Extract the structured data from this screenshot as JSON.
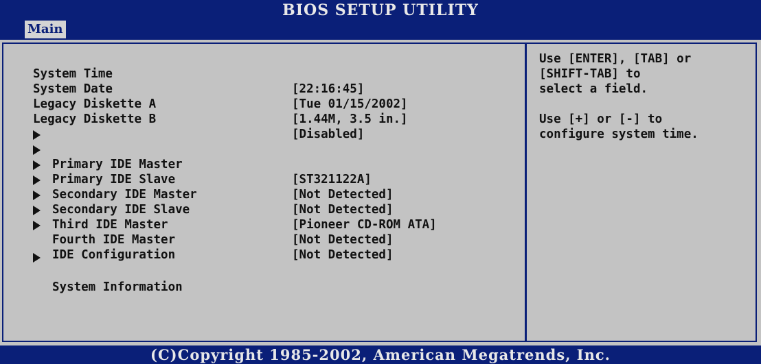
{
  "header": {
    "title": "BIOS SETUP UTILITY",
    "active_tab": "Main"
  },
  "settings": {
    "system_time": {
      "label": "System Time",
      "value": "[22:16:45]"
    },
    "system_date": {
      "label": "System Date",
      "value": "[Tue 01/15/2002]"
    },
    "diskette_a": {
      "label": "Legacy Diskette A",
      "value": "[1.44M, 3.5 in.]"
    },
    "diskette_b": {
      "label": "Legacy Diskette B",
      "value": "[Disabled]"
    },
    "primary_master": {
      "label": "Primary IDE Master",
      "value": "[ST321122A]"
    },
    "primary_slave": {
      "label": "Primary IDE Slave",
      "value": "[Not Detected]"
    },
    "secondary_master": {
      "label": "Secondary IDE Master",
      "value": "[Not Detected]"
    },
    "secondary_slave": {
      "label": "Secondary IDE Slave",
      "value": "[Pioneer CD-ROM ATA]"
    },
    "third_master": {
      "label": "Third IDE Master",
      "value": "[Not Detected]"
    },
    "fourth_master": {
      "label": "Fourth IDE Master",
      "value": "[Not Detected]"
    },
    "ide_config": {
      "label": "IDE Configuration"
    },
    "system_info": {
      "label": "System Information"
    }
  },
  "help": {
    "line1": "Use [ENTER], [TAB] or",
    "line2": "[SHIFT-TAB] to",
    "line3": "select a field.",
    "line4": "Use [+] or [-] to",
    "line5": "configure system time."
  },
  "footer": {
    "copyright": "(C)Copyright 1985-2002, American Megatrends, Inc."
  },
  "colors": {
    "frame_blue": "#0a1f78",
    "panel_gray": "#c3c3c3",
    "tab_gray": "#d4d4d4"
  }
}
